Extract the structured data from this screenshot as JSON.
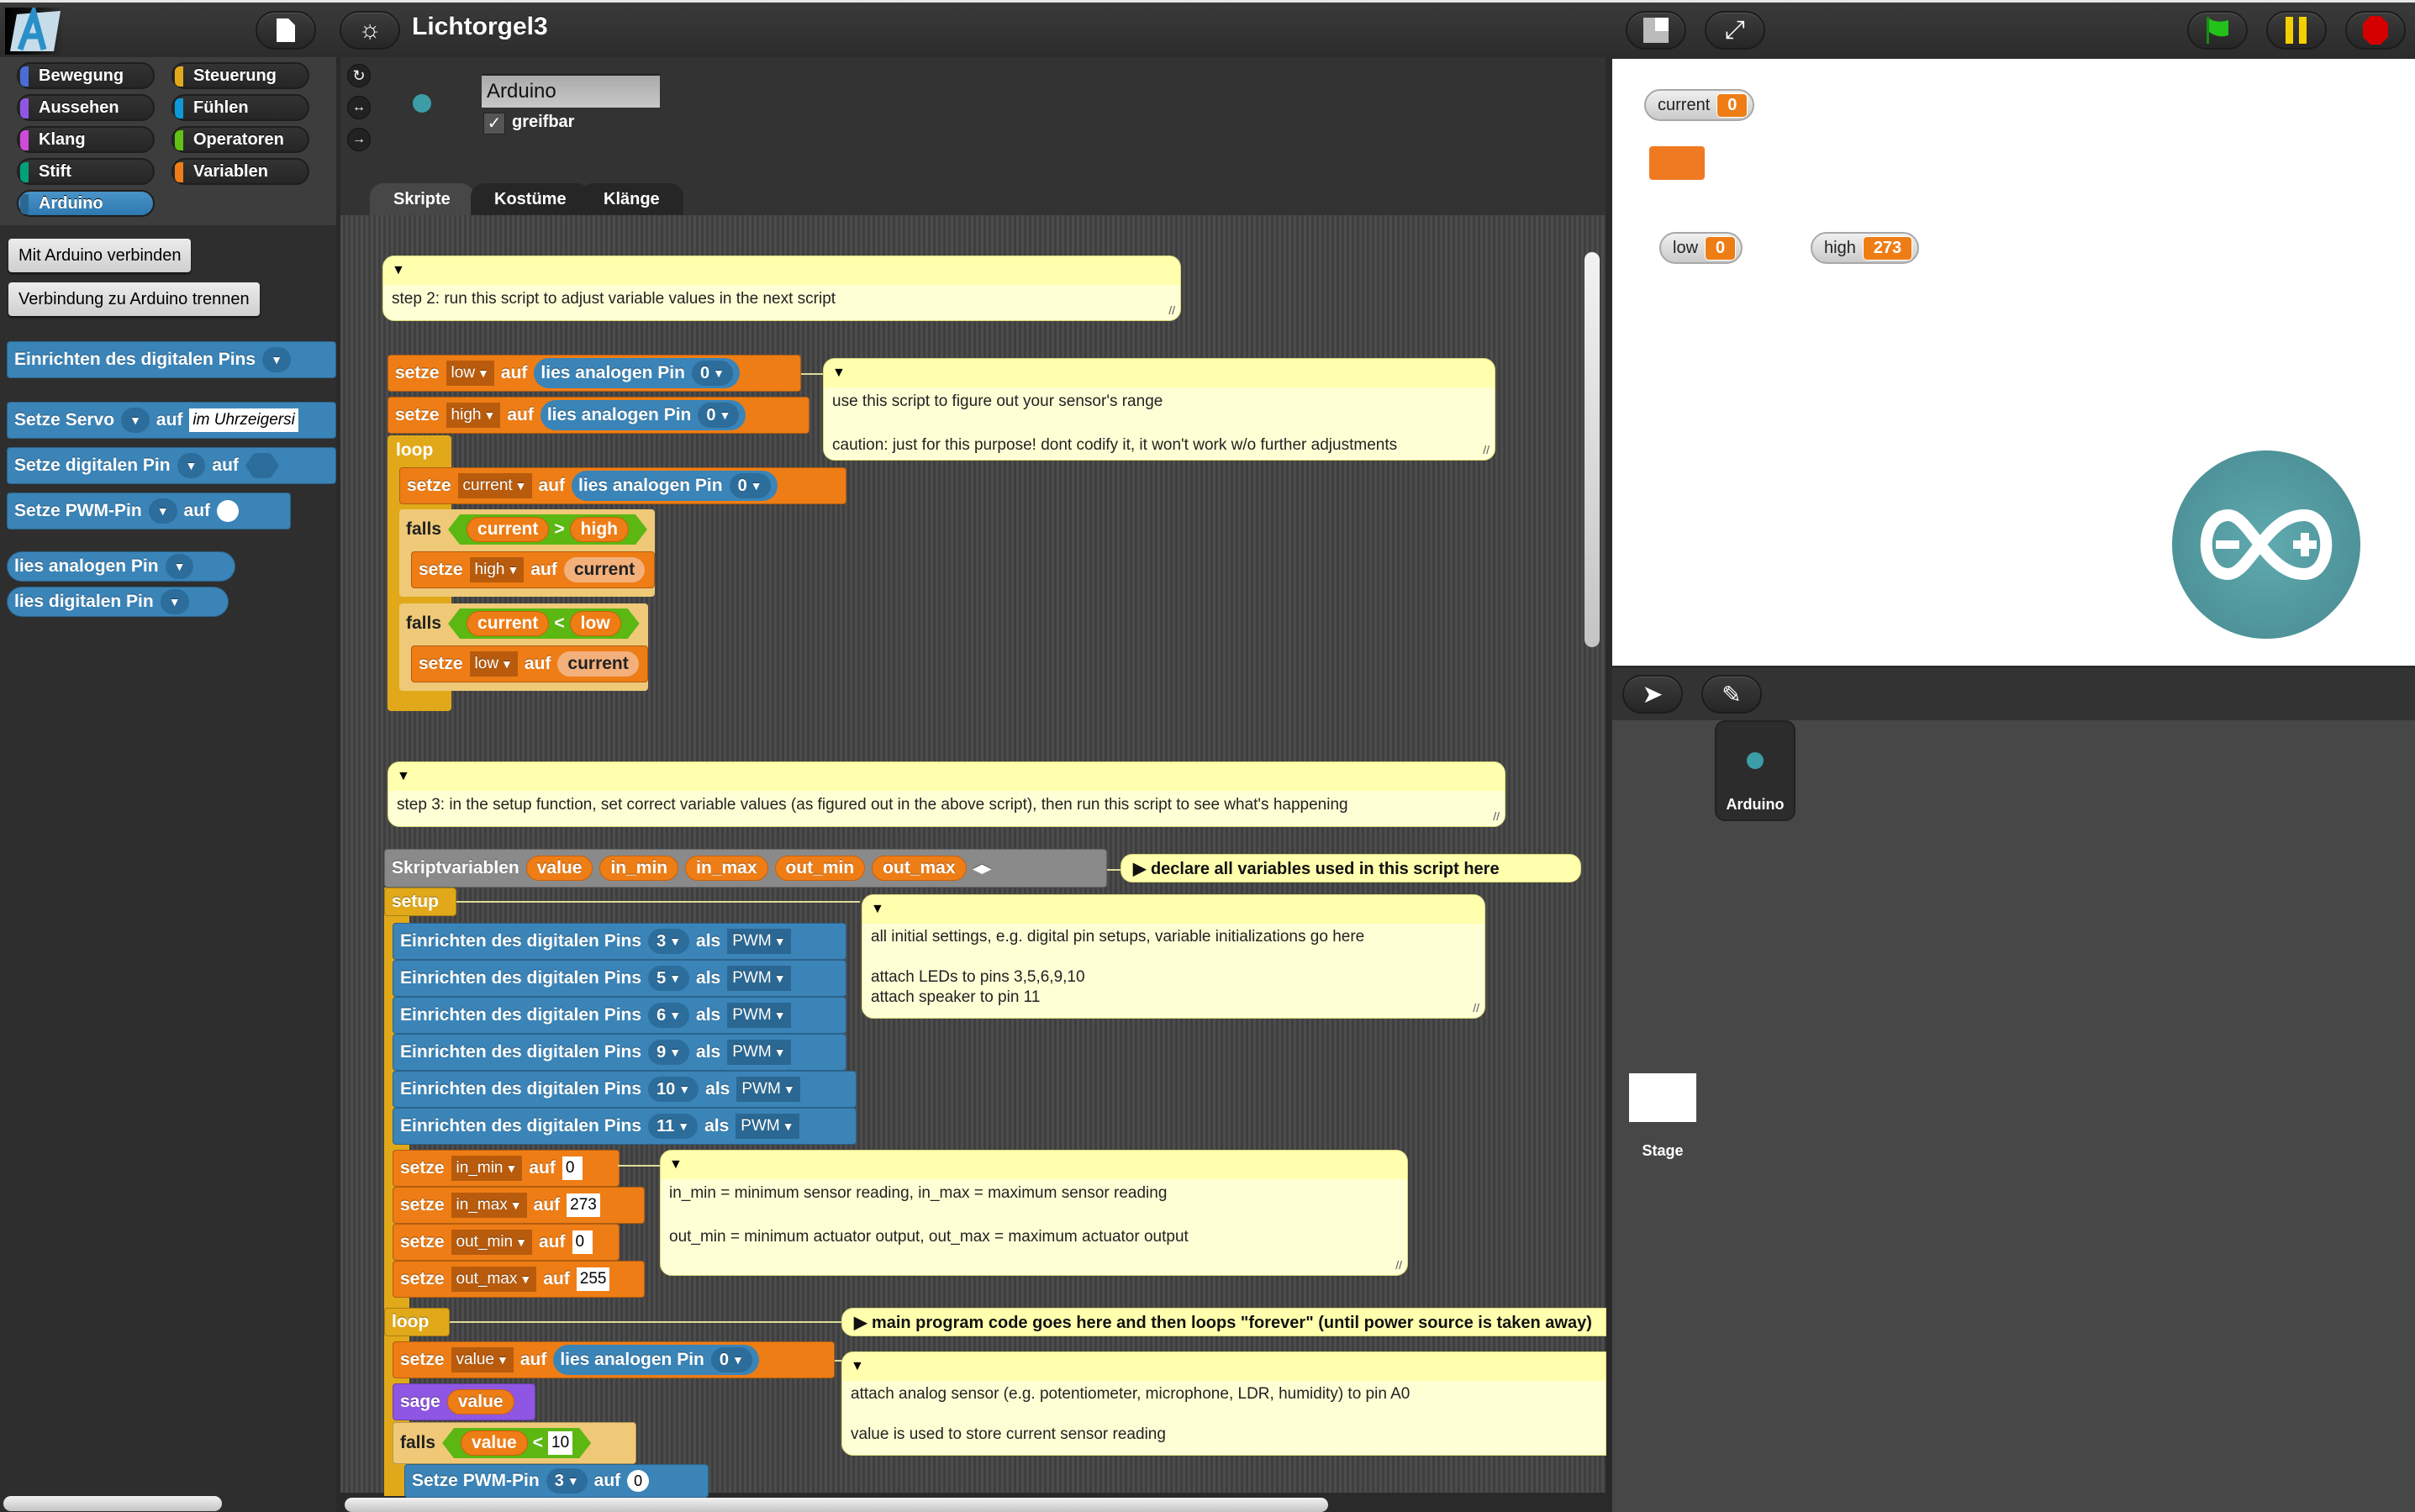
{
  "app": {
    "project_title": "Lichtorgel3",
    "icons": {
      "logo": "snap4arduino-logo",
      "file": "file-icon",
      "settings": "gear-icon"
    }
  },
  "stage_toolbar": {
    "buttons": [
      "normal-stage-icon",
      "fullscreen-icon",
      "green-flag-icon",
      "pause-icon",
      "stop-icon"
    ],
    "colors": {
      "flag": "#22c21a",
      "pause": "#f5d000",
      "stop": "#d40000"
    }
  },
  "categories": [
    {
      "label": "Bewegung",
      "color": "#4a6cd4"
    },
    {
      "label": "Steuerung",
      "color": "#e1a91a"
    },
    {
      "label": "Aussehen",
      "color": "#8f56e3"
    },
    {
      "label": "Fühlen",
      "color": "#0e9ad8"
    },
    {
      "label": "Klang",
      "color": "#cf4ad9"
    },
    {
      "label": "Operatoren",
      "color": "#62c213"
    },
    {
      "label": "Stift",
      "color": "#00a178"
    },
    {
      "label": "Variablen",
      "color": "#ee7d16"
    },
    {
      "label": "Arduino",
      "color": "#3a84b8",
      "active": true
    }
  ],
  "palette": {
    "connect_button": "Mit Arduino verbinden",
    "disconnect_button": "Verbindung zu Arduino trennen",
    "blocks": {
      "setup_pin": "Einrichten des digitalen Pins",
      "servo_prefix": "Setze Servo",
      "servo_auf": "auf",
      "servo_value": "im Uhrzeigersi",
      "digital_prefix": "Setze digitalen Pin",
      "digital_auf": "auf",
      "pwm_prefix": "Setze PWM-Pin",
      "pwm_auf": "auf",
      "read_analog": "lies analogen Pin",
      "read_digital": "lies digitalen Pin"
    }
  },
  "sprite": {
    "name": "Arduino",
    "draggable_label": "greifbar",
    "draggable_checked": true,
    "rotation_icons": [
      "rotate-icon",
      "flip-horizontal-icon",
      "no-rotate-icon"
    ]
  },
  "tabs": [
    {
      "label": "Skripte",
      "active": true
    },
    {
      "label": "Kostüme"
    },
    {
      "label": "Klänge"
    }
  ],
  "keywords": {
    "setze": "setze",
    "auf": "auf",
    "falls": "falls",
    "loop": "loop",
    "setup": "setup",
    "sage": "sage",
    "als": "als",
    "einrichten": "Einrichten des digitalen Pins",
    "lies_analog": "lies analogen Pin",
    "skriptvariablen": "Skriptvariablen",
    "setze_pwm": "Setze PWM-Pin"
  },
  "comments": {
    "step2": "step 2: run this script to adjust variable values in the next script",
    "range": "use this script to figure out your sensor's range\n\ncaution: just for this purpose! dont codify it, it won't work w/o further adjustments",
    "step3": "step 3: in the setup function, set correct variable values (as figured out in the above script), then run this script to see what's happening",
    "declare": "declare all variables used in this script here",
    "setup": "all initial settings, e.g. digital pin setups, variable initializations go here\n\nattach LEDs to pins 3,5,6,9,10\nattach speaker to pin 11",
    "minmax": "in_min = minimum sensor reading, in_max = maximum sensor reading\n\nout_min = minimum actuator output, out_max = maximum actuator output",
    "mainloop": "main program code goes here and then loops \"forever\" (until power source is taken away)",
    "sensor": "attach analog sensor (e.g. potentiometer, microphone, LDR, humidity) to pin A0\n\nvalue is used to store current sensor reading"
  },
  "script1": {
    "set_low": {
      "var": "low",
      "pin": "0"
    },
    "set_high": {
      "var": "high",
      "pin": "0"
    },
    "set_current": {
      "var": "current",
      "pin": "0"
    },
    "if1": {
      "left": "current",
      "op": ">",
      "right": "high",
      "set_var": "high",
      "set_val": "current"
    },
    "if2": {
      "left": "current",
      "op": "<",
      "right": "low",
      "set_var": "low",
      "set_val": "current"
    }
  },
  "script2": {
    "script_vars": [
      "value",
      "in_min",
      "in_max",
      "out_min",
      "out_max"
    ],
    "pin_setups": [
      {
        "pin": "3",
        "mode": "PWM"
      },
      {
        "pin": "5",
        "mode": "PWM"
      },
      {
        "pin": "6",
        "mode": "PWM"
      },
      {
        "pin": "9",
        "mode": "PWM"
      },
      {
        "pin": "10",
        "mode": "PWM"
      },
      {
        "pin": "11",
        "mode": "PWM"
      }
    ],
    "var_inits": [
      {
        "var": "in_min",
        "value": "0"
      },
      {
        "var": "in_max",
        "value": "273"
      },
      {
        "var": "out_min",
        "value": "0"
      },
      {
        "var": "out_max",
        "value": "255"
      }
    ],
    "loop": {
      "set_value": {
        "var": "value",
        "pin": "0"
      },
      "say": "value",
      "if": {
        "left": "value",
        "op": "<",
        "right": "10"
      },
      "pwm": {
        "pin": "3",
        "value": "0"
      }
    }
  },
  "stage": {
    "watchers": [
      {
        "name": "current",
        "value": "0"
      },
      {
        "name": "low",
        "value": "0"
      },
      {
        "name": "high",
        "value": "273"
      }
    ],
    "sprite_costume": "arduino-logo"
  },
  "corral": {
    "tools": [
      "turtle-icon",
      "paint-brush-icon"
    ],
    "sprites": [
      {
        "name": "Arduino"
      }
    ],
    "stage_label": "Stage"
  }
}
